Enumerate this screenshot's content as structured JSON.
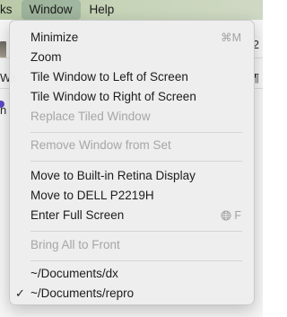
{
  "menubar": {
    "items": [
      "ks",
      "Window",
      "Help"
    ]
  },
  "background": {
    "left_texts": [
      "Wa",
      "n",
      "l"
    ],
    "right_texts": [
      "",
      "2",
      "¶"
    ]
  },
  "window_menu": {
    "minimize": {
      "label": "Minimize",
      "shortcut": "⌘M"
    },
    "zoom": {
      "label": "Zoom"
    },
    "tile_left": {
      "label": "Tile Window to Left of Screen"
    },
    "tile_right": {
      "label": "Tile Window to Right of Screen"
    },
    "replace_tiled": {
      "label": "Replace Tiled Window"
    },
    "remove_from_set": {
      "label": "Remove Window from Set"
    },
    "move_builtin": {
      "label": "Move to Built-in Retina Display"
    },
    "move_dell": {
      "label": "Move to DELL P2219H"
    },
    "full_screen": {
      "label": "Enter Full Screen",
      "shortcut": "F",
      "shortcut_icon": "globe-icon"
    },
    "bring_all_front": {
      "label": "Bring All to Front"
    },
    "windows": [
      {
        "label": "~/Documents/dx",
        "checked": false
      },
      {
        "label": "~/Documents/repro",
        "checked": true,
        "check_glyph": "✓"
      }
    ]
  }
}
